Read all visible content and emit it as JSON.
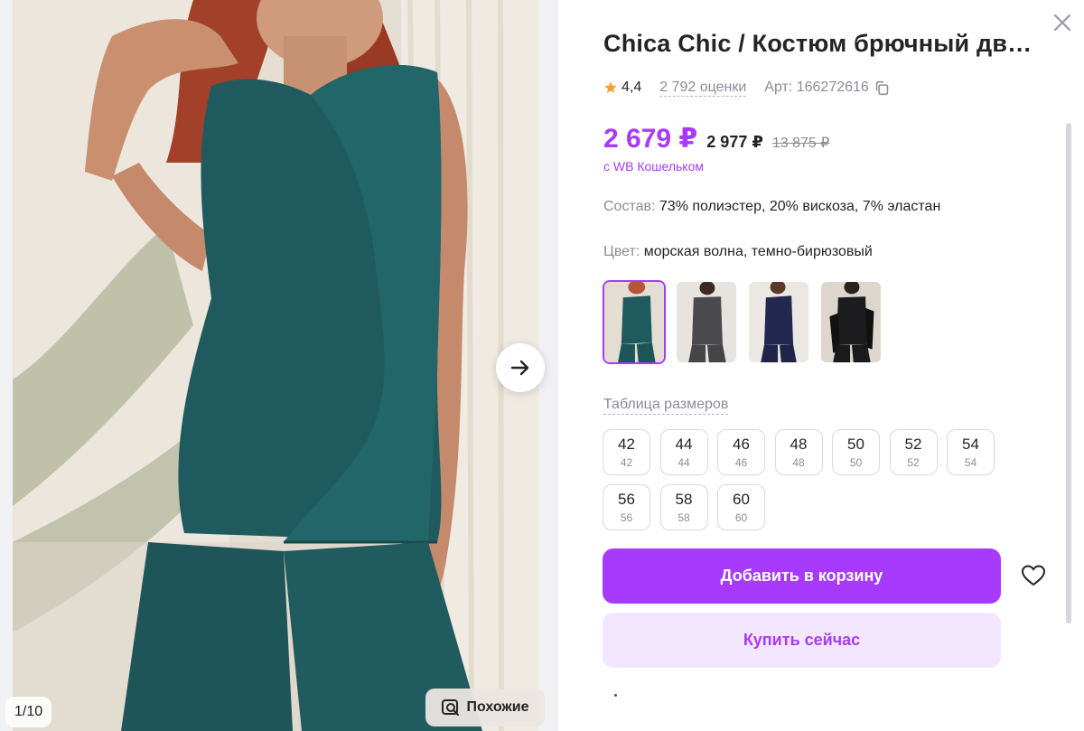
{
  "gallery": {
    "counter": "1/10",
    "similar_label": "Похожие",
    "next_icon": "arrow-right-icon",
    "similar_icon": "search-image-icon"
  },
  "product": {
    "title": "Chica Chic / Костюм брючный дв…",
    "rating": "4,4",
    "reviews": "2 792 оценки",
    "article": "Арт: 166272616",
    "price_current": "2 679 ₽",
    "price_base": "2 977 ₽",
    "price_old": "13 875 ₽",
    "wallet_note": "с WB Кошельком",
    "composition_label": "Состав:",
    "composition_value": "73% полиэстер, 20% вискоза, 7% эластан",
    "color_label": "Цвет:",
    "color_value": "морская волна, темно-бирюзовый"
  },
  "colors": [
    {
      "name": "teal",
      "hex": "#1f5a5e",
      "active": true
    },
    {
      "name": "graphite",
      "hex": "#4a4a4c",
      "active": false
    },
    {
      "name": "navy",
      "hex": "#22284f",
      "active": false
    },
    {
      "name": "black",
      "hex": "#1c1c1e",
      "active": false
    }
  ],
  "size_table_label": "Таблица размеров",
  "sizes": [
    {
      "ru": "42",
      "eu": "42"
    },
    {
      "ru": "44",
      "eu": "44"
    },
    {
      "ru": "46",
      "eu": "46"
    },
    {
      "ru": "48",
      "eu": "48"
    },
    {
      "ru": "50",
      "eu": "50"
    },
    {
      "ru": "52",
      "eu": "52"
    },
    {
      "ru": "54",
      "eu": "54"
    },
    {
      "ru": "56",
      "eu": "56"
    },
    {
      "ru": "58",
      "eu": "58"
    },
    {
      "ru": "60",
      "eu": "60"
    }
  ],
  "actions": {
    "add_to_cart": "Добавить в корзину",
    "buy_now": "Купить сейчас"
  },
  "theme": {
    "accent": "#a73afd",
    "accent_light": "#f3e6ff",
    "star": "#ff9f2d"
  }
}
